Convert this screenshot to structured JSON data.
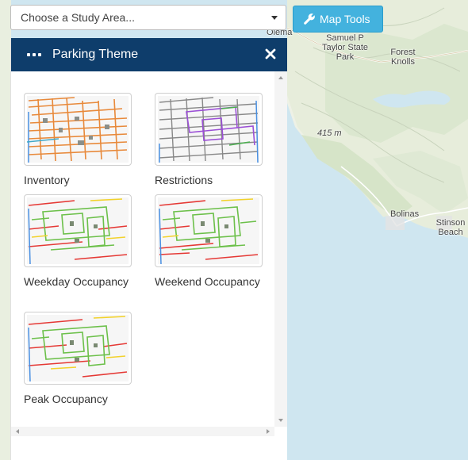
{
  "study_area": {
    "selected_label": "Choose a Study Area...",
    "options": []
  },
  "map_tools": {
    "label": "Map Tools",
    "icon": "wrench-icon"
  },
  "panel": {
    "title": "Parking Theme",
    "menu_icon": "ellipsis-icon",
    "close_icon": "close-icon",
    "header_color": "#0e3d6b",
    "themes": [
      {
        "label": "Inventory",
        "style": "inventory"
      },
      {
        "label": "Restrictions",
        "style": "restrictions"
      },
      {
        "label": "Weekday Occupancy",
        "style": "occupancy"
      },
      {
        "label": "Weekend Occupancy",
        "style": "occupancy"
      },
      {
        "label": "Peak Occupancy",
        "style": "occupancy"
      }
    ]
  },
  "map": {
    "labels": {
      "olema": "Olema",
      "samuel_p_taylor": "Samuel P Taylor State Park",
      "forest_knolls": "Forest Knolls",
      "elevation": "415 m",
      "bolinas": "Bolinas",
      "stinson_beach": "Stinson Beach"
    },
    "colors": {
      "water": "#cfe6f0",
      "land": "#eef1e6",
      "forest": "#d8e6cc",
      "accent": "#43b2de"
    }
  }
}
